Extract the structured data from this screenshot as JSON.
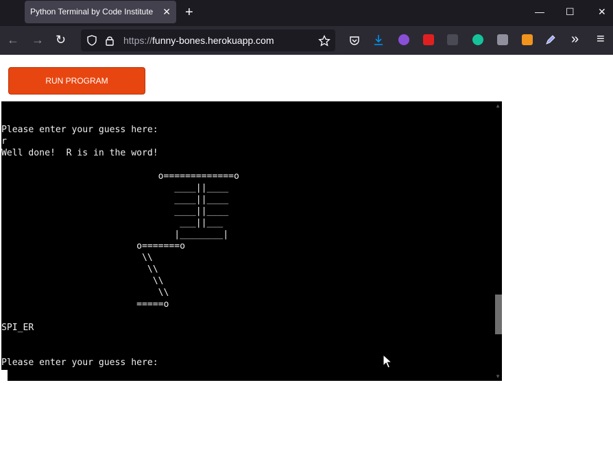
{
  "browser": {
    "tab_title": "Python Terminal by Code Institute",
    "tab_close": "✕",
    "new_tab": "+",
    "url_scheme": "https://",
    "url_host": "funny-bones.herokuapp.com",
    "controls": {
      "minimize": "—",
      "maximize": "☐",
      "close": "✕"
    },
    "nav": {
      "back": "←",
      "forward": "→",
      "reload": "↻",
      "overflow": "»",
      "menu": "≡"
    }
  },
  "page": {
    "run_button": "RUN PROGRAM"
  },
  "terminal": {
    "output": "Please enter your guess here:\nr\nWell done!  R is in the word!\n\n                             o=============o\n                                ____||____\n                                ____||____\n                                ____||____\n                                 ___||___\n                                |________|\n                         o=======o\n                          \\\\\n                           \\\\\n                            \\\\\n                             \\\\\n                         =====o\n\nSPI_ER\n\n\nPlease enter your guess here:",
    "scroll_position": 0.85
  }
}
